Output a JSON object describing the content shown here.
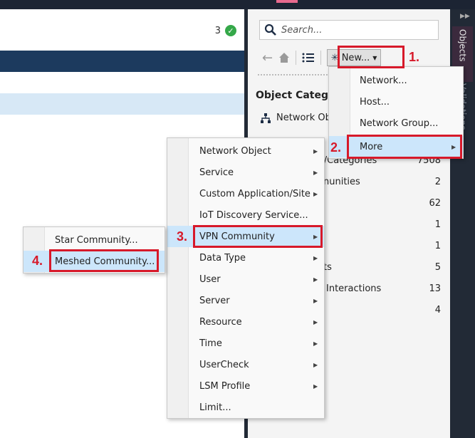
{
  "main": {
    "validation_count": "3"
  },
  "right_panel": {
    "search_placeholder": "Search...",
    "new_button_label": "New...",
    "categories_title": "Object Categor",
    "first_category_label": "Network Ob",
    "rows": [
      {
        "label": "s/Categories",
        "count": "7508"
      },
      {
        "label": "nunities",
        "count": "2"
      },
      {
        "label": "",
        "count": "62"
      },
      {
        "label": "",
        "count": "1"
      },
      {
        "label": "",
        "count": "1"
      },
      {
        "label": "ts",
        "count": "5"
      },
      {
        "label": "Interactions",
        "count": "13"
      },
      {
        "label": "",
        "count": "4"
      }
    ]
  },
  "side_strip": {
    "objects_tab": "Objects",
    "validations_tab": "Validations"
  },
  "new_menu": {
    "items": [
      "Network...",
      "Host...",
      "Network Group...",
      "More"
    ]
  },
  "more_menu": {
    "items": [
      "Network Object",
      "Service",
      "Custom Application/Site",
      "IoT Discovery Service...",
      "VPN Community",
      "Data Type",
      "User",
      "Server",
      "Resource",
      "Time",
      "UserCheck",
      "LSM Profile",
      "Limit..."
    ]
  },
  "vpn_menu": {
    "items": [
      "Star Community...",
      "Meshed Community..."
    ]
  },
  "steps": [
    "1.",
    "2.",
    "3.",
    "4."
  ],
  "colors": {
    "annotation_red": "#d7192a",
    "highlight": "#cce6fb",
    "header_navy": "#1c3a5e"
  }
}
